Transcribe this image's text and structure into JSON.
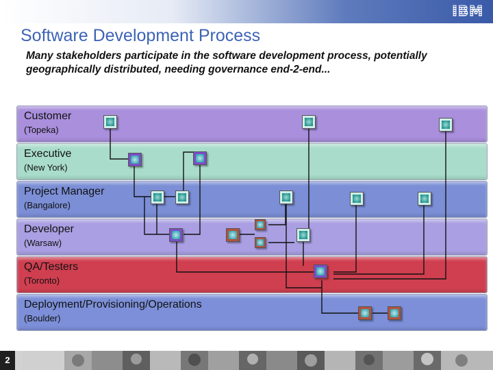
{
  "header": {
    "logo": "IBM",
    "title": "Software Development Process",
    "subtitle": "Many stakeholders participate in the software development process, potentially geographically distributed, needing governance end-2-end..."
  },
  "lanes": [
    {
      "role": "Customer",
      "location": "(Topeka)",
      "color": "#a98fdc"
    },
    {
      "role": "Executive",
      "location": "(New York)",
      "color": "#a9dccb"
    },
    {
      "role": "Project Manager",
      "location": "(Bangalore)",
      "color": "#7b8ed6"
    },
    {
      "role": "Developer",
      "location": "(Warsaw)",
      "color": "#a99fe2"
    },
    {
      "role": "QA/Testers",
      "location": "(Toronto)",
      "color": "#cf3f50"
    },
    {
      "role": "Deployment/Provisioning/Operations",
      "location": "(Boulder)",
      "color": "#7c8fd8"
    }
  ],
  "footer": {
    "page_number": "2"
  }
}
